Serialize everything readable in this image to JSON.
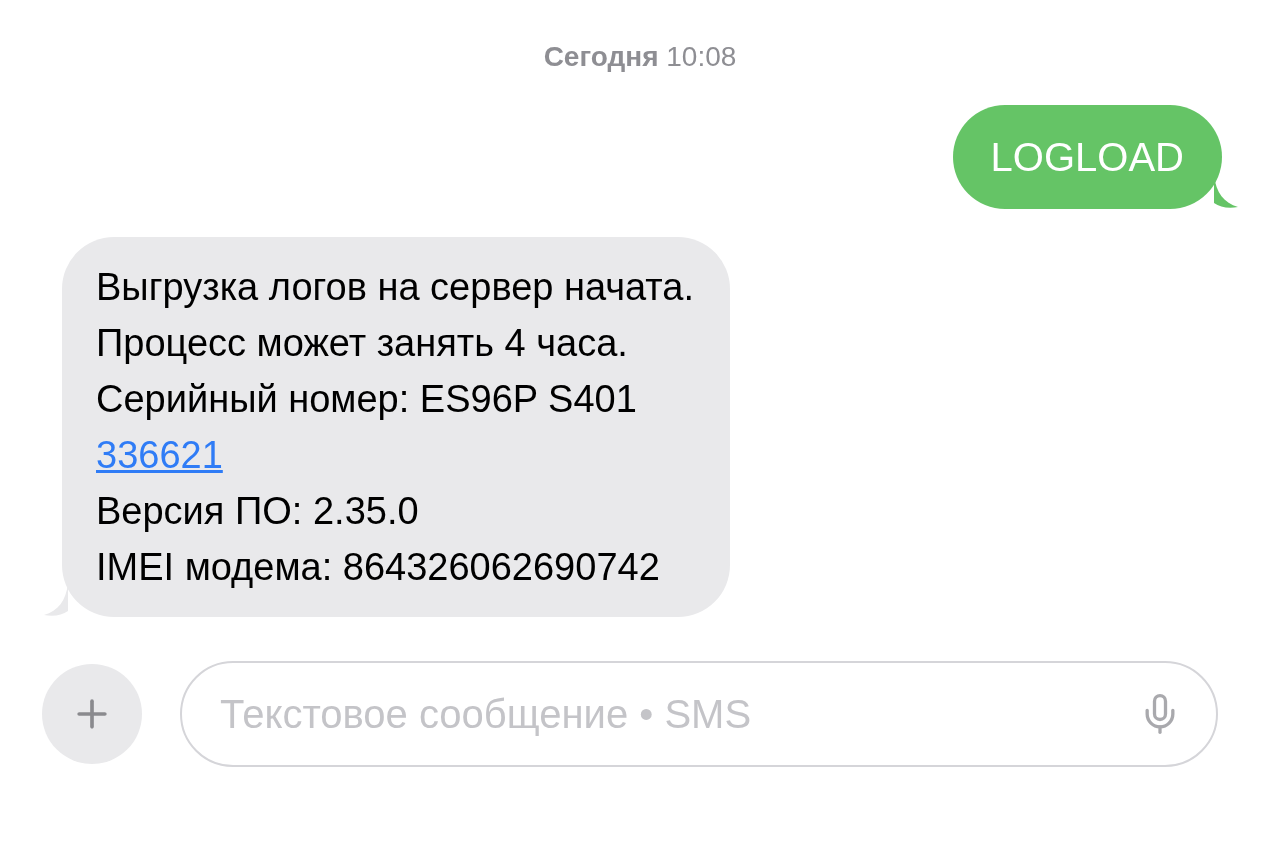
{
  "timestamp": "**Сегодня** 10:08",
  "messages": [
    {
      "kind": "outgoing",
      "lines": [
        {
          "kind": "text",
          "text": "LOGLOAD"
        }
      ]
    },
    {
      "kind": "incoming",
      "lines": [
        {
          "kind": "text",
          "text": "Выгрузка логов на сервер начата."
        },
        {
          "kind": "text",
          "text": "Процесс может занять 4 часа."
        },
        {
          "kind": "text",
          "text": "Серийный номер: ES96P S401"
        },
        {
          "kind": "link",
          "text": "336621"
        },
        {
          "kind": "text",
          "text": "Версия ПО: 2.35.0"
        },
        {
          "kind": "text",
          "text": "IMEI модема: 864326062690742"
        }
      ]
    }
  ],
  "composer": {
    "placeholder": "Текстовое сообщение • SMS"
  }
}
